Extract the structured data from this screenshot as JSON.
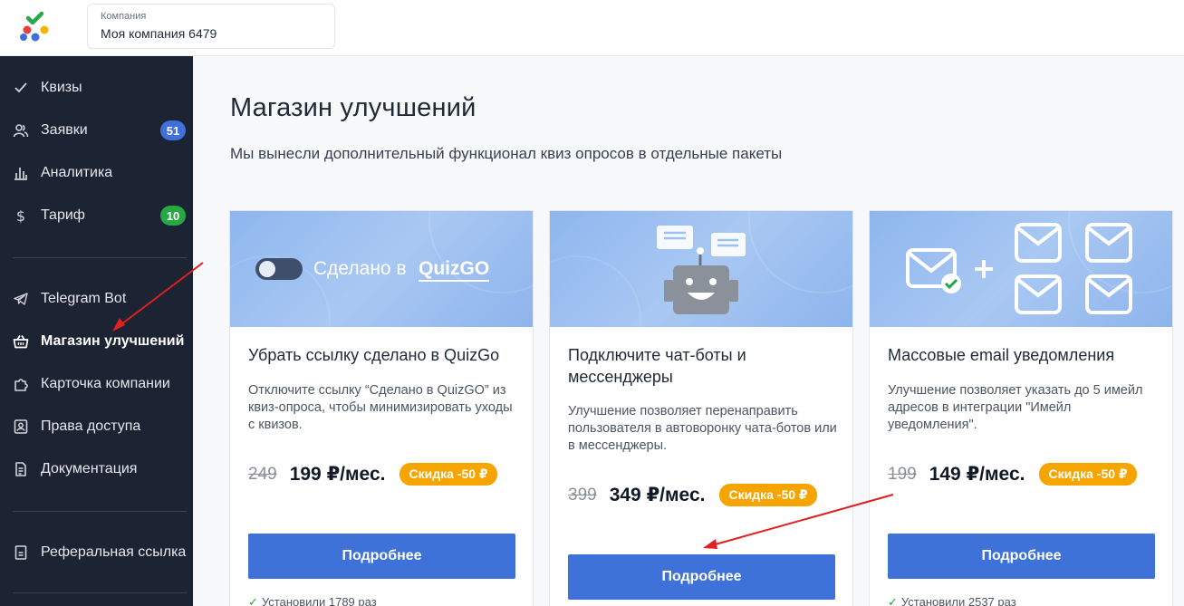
{
  "header": {
    "company_label": "Компания",
    "company_name": "Моя компания 6479"
  },
  "sidebar": {
    "items": [
      {
        "label": "Квизы",
        "icon": "check-icon"
      },
      {
        "label": "Заявки",
        "icon": "users-icon",
        "badge": "51"
      },
      {
        "label": "Аналитика",
        "icon": "bar-chart-icon"
      },
      {
        "label": "Тариф",
        "icon": "dollar-icon",
        "badge": "10"
      },
      {
        "label": "Telegram Bot",
        "icon": "telegram-icon"
      },
      {
        "label": "Магазин улучшений",
        "icon": "basket-icon",
        "active": true
      },
      {
        "label": "Карточка компании",
        "icon": "puzzle-icon"
      },
      {
        "label": "Права доступа",
        "icon": "id-card-icon"
      },
      {
        "label": "Документация",
        "icon": "document-icon"
      },
      {
        "label": "Реферальная ссылка",
        "icon": "link-doc-icon"
      }
    ],
    "badge_colors": {
      "leads": "#3f6fd8",
      "tariff": "#27a844"
    }
  },
  "main": {
    "title": "Магазин улучшений",
    "subtitle": "Мы вынесли дополнительный функционал квиз опросов в отдельные пакеты",
    "cards": [
      {
        "hero_text": "Сделано в",
        "hero_brand": "QuizGO",
        "title": "Убрать ссылку сделано в QuizGo",
        "description": "Отключите ссылку “Сделано в QuizGO” из квиз-опроса, чтобы минимизировать уходы с квизов.",
        "old_price": "249",
        "new_price": "199 ₽/мес.",
        "discount": "Скидка -50 ₽",
        "button": "Подробнее",
        "installs": "Установили 1789 раз"
      },
      {
        "title": "Подключите чат-боты и мессенджеры",
        "description": "Улучшение позволяет перенаправить пользователя в автоворонку чата-ботов или в мессенджеры.",
        "old_price": "399",
        "new_price": "349 ₽/мес.",
        "discount": "Скидка -50 ₽",
        "button": "Подробнее"
      },
      {
        "title": "Массовые email уведомления",
        "description": "Улучшение позволяет указать до 5 имейл адресов в интеграции \"Имейл уведомления\".",
        "old_price": "199",
        "new_price": "149 ₽/мес.",
        "discount": "Скидка -50 ₽",
        "button": "Подробнее",
        "installs": "Установили 2537 раз"
      }
    ]
  },
  "colors": {
    "sidebar_bg": "#1c2333",
    "accent_button": "#3f72d9",
    "discount_badge": "#f5a400",
    "annotation_arrow": "#e02020"
  }
}
